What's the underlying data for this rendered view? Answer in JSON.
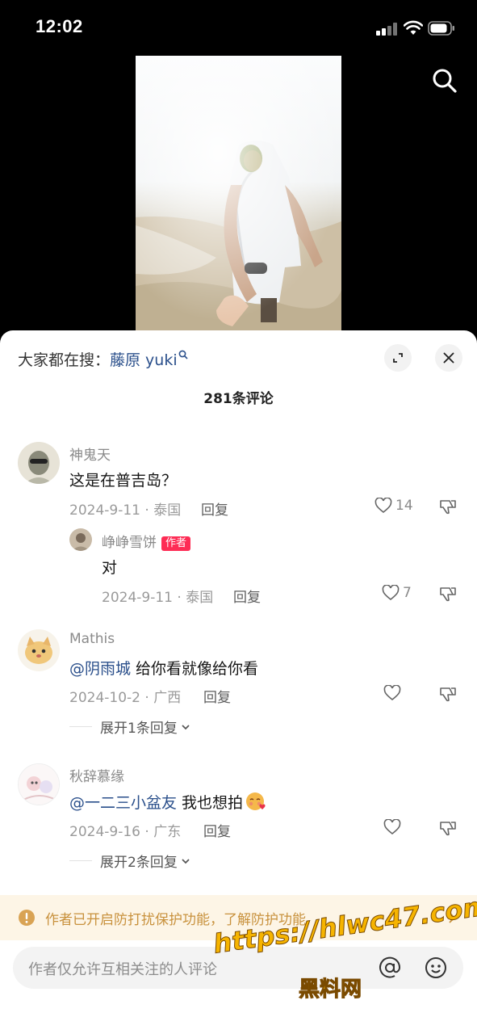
{
  "status_bar": {
    "time": "12:02"
  },
  "sheet": {
    "hot_search_prefix": "大家都在搜：",
    "hot_search_term": "藤原 yuki",
    "comment_count": "281条评论"
  },
  "comments": [
    {
      "author": "神鬼天",
      "text": "这是在普吉岛？",
      "meta": "2024-9-11 · 泰国",
      "reply_label": "回复",
      "likes": "14"
    },
    {
      "author": "峥峥雪饼",
      "badge": "作者",
      "text": "对",
      "meta": "2024-9-11 · 泰国",
      "reply_label": "回复",
      "likes": "7"
    },
    {
      "author": "Mathis",
      "mention": "@阴雨城",
      "text": " 给你看就像给你看",
      "meta": "2024-10-2 · 广西",
      "reply_label": "回复",
      "expand": "展开1条回复"
    },
    {
      "author": "秋辞慕缘",
      "mention": "@一二三小盆友",
      "text": " 我也想拍",
      "meta": "2024-9-16 · 广东",
      "reply_label": "回复",
      "expand": "展开2条回复"
    }
  ],
  "notice": {
    "text": "作者已开启防打扰保护功能，了解防护功能"
  },
  "input": {
    "placeholder": "作者仅允许互相关注的人评论"
  },
  "watermark": {
    "url": "https://hlwc47.com",
    "name": "黑料网"
  },
  "colors": {
    "accent_red": "#fe2c55",
    "mention_blue": "#2a4f8b",
    "notice_bg": "#fdf5e6",
    "notice_text": "#c8913c"
  }
}
